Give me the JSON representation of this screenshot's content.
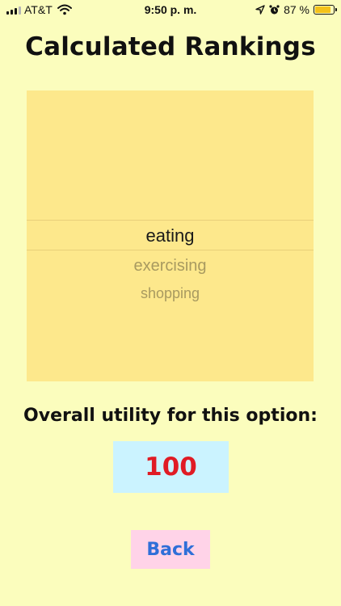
{
  "status_bar": {
    "carrier": "AT&T",
    "time": "9:50 p. m.",
    "battery_percent": "87 %",
    "battery_level": 0.87,
    "icons": [
      "signal-icon",
      "wifi-icon",
      "location-icon",
      "alarm-icon",
      "battery-icon"
    ]
  },
  "page": {
    "title": "Calculated Rankings"
  },
  "picker": {
    "selected": "eating",
    "items_below": [
      "exercising",
      "shopping"
    ]
  },
  "utility": {
    "label": "Overall utility for this option:",
    "value": "100"
  },
  "back_button": {
    "label": "Back"
  },
  "colors": {
    "background": "#fbfdbd",
    "picker_bg": "#fde88c",
    "utility_box_bg": "#cbf3ff",
    "utility_value": "#e01b24",
    "back_button_bg": "#ffd3e8",
    "back_button_text": "#2f6fd8",
    "battery_fill": "#f4c21a"
  }
}
